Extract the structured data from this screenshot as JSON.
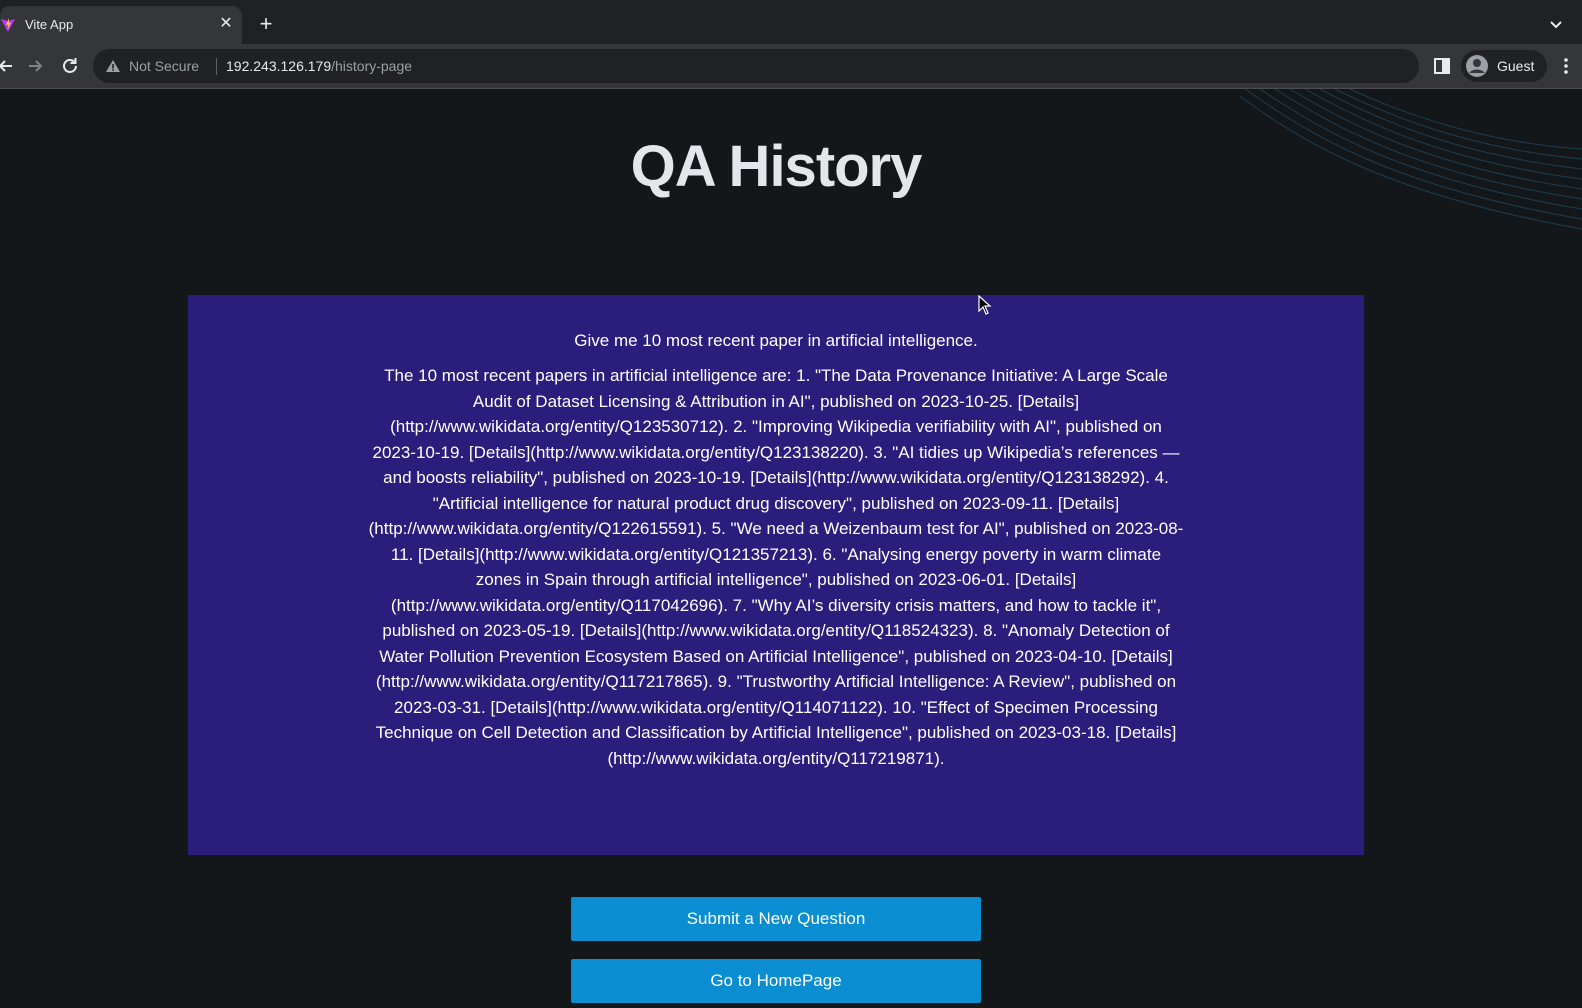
{
  "browser": {
    "tab_title": "Vite App",
    "security_label": "Not Secure",
    "url_host": "192.243.126.179",
    "url_path": "/history-page",
    "profile_label": "Guest"
  },
  "page": {
    "title": "QA History",
    "qa": {
      "question": "Give me 10 most recent paper in artificial intelligence.",
      "answer": "The 10 most recent papers in artificial intelligence are: 1. \"The Data Provenance Initiative: A Large Scale Audit of Dataset Licensing & Attribution in AI\", published on 2023-10-25. [Details](http://www.wikidata.org/entity/Q123530712). 2. \"Improving Wikipedia verifiability with AI\", published on 2023-10-19. [Details](http://www.wikidata.org/entity/Q123138220). 3. \"AI tidies up Wikipedia’s references — and boosts reliability\", published on 2023-10-19. [Details](http://www.wikidata.org/entity/Q123138292). 4. \"Artificial intelligence for natural product drug discovery\", published on 2023-09-11. [Details](http://www.wikidata.org/entity/Q122615591). 5. \"We need a Weizenbaum test for AI\", published on 2023-08-11. [Details](http://www.wikidata.org/entity/Q121357213). 6. \"Analysing energy poverty in warm climate zones in Spain through artificial intelligence\", published on 2023-06-01. [Details](http://www.wikidata.org/entity/Q117042696). 7. \"Why AI’s diversity crisis matters, and how to tackle it\", published on 2023-05-19. [Details](http://www.wikidata.org/entity/Q118524323). 8. \"Anomaly Detection of Water Pollution Prevention Ecosystem Based on Artificial Intelligence\", published on 2023-04-10. [Details](http://www.wikidata.org/entity/Q117217865). 9. \"Trustworthy Artificial Intelligence: A Review\", published on 2023-03-31. [Details](http://www.wikidata.org/entity/Q114071122). 10. \"Effect of Specimen Processing Technique on Cell Detection and Classification by Artificial Intelligence\", published on 2023-03-18. [Details](http://www.wikidata.org/entity/Q117219871)."
    },
    "buttons": {
      "submit_label": "Submit a New Question",
      "home_label": "Go to HomePage"
    }
  },
  "colors": {
    "page_background": "#141719",
    "card_background": "#2a1d7c",
    "button_background": "#0a8ed1",
    "title_text": "#e3e6ea"
  },
  "icons": {
    "favicon": "vite-logo-icon",
    "close": "close-icon",
    "new_tab": "plus-icon",
    "back": "arrow-left-icon",
    "forward": "arrow-right-icon",
    "reload": "reload-icon",
    "security": "warning-triangle-icon",
    "side_panel": "side-panel-icon",
    "profile": "person-avatar-icon",
    "menu": "kebab-menu-icon"
  }
}
